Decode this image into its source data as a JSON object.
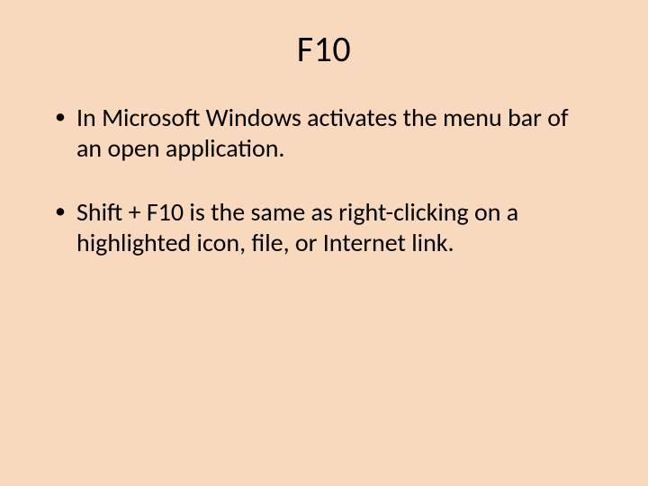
{
  "title": "F10",
  "bullets": [
    "In Microsoft Windows activates the menu bar of an open application.",
    "Shift + F10 is the same as right-clicking on a highlighted icon, file, or Internet link."
  ]
}
